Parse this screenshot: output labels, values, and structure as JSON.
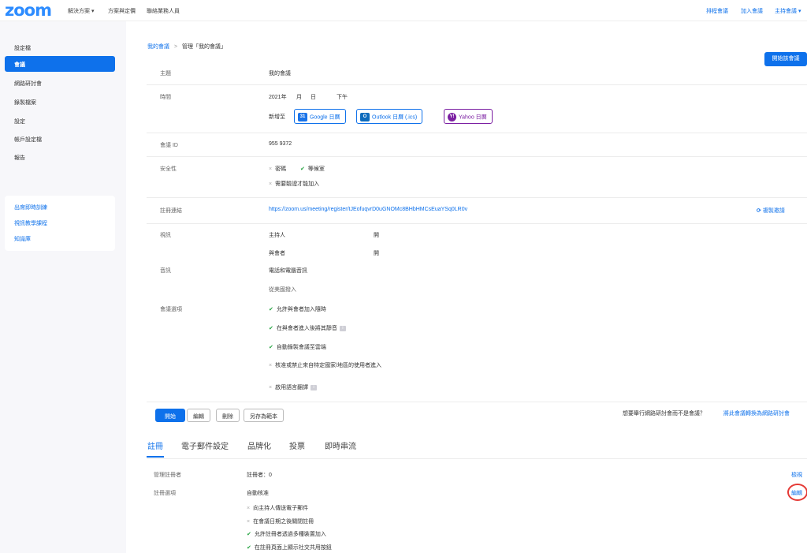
{
  "topbar": {
    "logo": "zoom",
    "nav": [
      "解決方案 ▾",
      "方案與定價",
      "聯絡業務人員"
    ],
    "right": [
      "排程會議",
      "加入會議",
      "主持會議 ▾"
    ]
  },
  "sidebar": {
    "items": [
      "設定檔",
      "會議",
      "網路研討會",
      "錄製檔案",
      "設定",
      "帳戶設定檔",
      "報告"
    ],
    "links": [
      "出席即時訓練",
      "視訊教學課程",
      "知識庫"
    ]
  },
  "breadcrumb": {
    "parent": "我的會議",
    "separator": ">",
    "current": "管理「我的會議」"
  },
  "start_meeting_button": "開始該會議",
  "meeting": {
    "topic_label": "主題",
    "topic": "我的會議",
    "time_label": "時間",
    "time_year": "2021年",
    "time_month": "月",
    "time_day": "日",
    "time_ampm": "下午",
    "add_to": "新增至",
    "google": "Google 日曆",
    "outlook": "Outlook 日曆 (.ics)",
    "yahoo": "Yahoo 日曆",
    "id_label": "會議 ID",
    "id": "955 9372",
    "security_label": "安全性",
    "security_passcode": "密碼",
    "security_waiting": "等候室",
    "security_auth": "需要驗證才能加入",
    "reg_link_label": "註冊連結",
    "reg_link": "https://zoom.us/meeting/register/tJEofuqvrD0uGNOMc8BHbHMCsEuaYSq0LR0v",
    "copy_invite": "複製邀請",
    "video_label": "視訊",
    "video_host": "主持人",
    "video_host_val": "開",
    "video_participant": "與會者",
    "video_participant_val": "開",
    "audio_label": "音訊",
    "audio_value": "電話和電腦音訊",
    "audio_dialin": "從美國撥入",
    "options_label": "會議選項",
    "opt1": "允許與會者加入隨時",
    "opt2": "在與會者進入後將其靜音",
    "opt3": "自動錄製會議至雲端",
    "opt4": "核准或禁止來自特定國家/地區的使用者進入",
    "opt5": "啟用語言翻譯"
  },
  "actions": {
    "start": "開始",
    "edit": "編輯",
    "delete": "刪除",
    "save_template": "另存為範本",
    "webinar_prompt": "想要舉行網路研討會而不是會議？",
    "webinar_link": "將此會議轉換為網路研討會"
  },
  "tabs": [
    "註冊",
    "電子郵件設定",
    "品牌化",
    "投票",
    "即時串流"
  ],
  "registration": {
    "manage_label": "管理註冊者",
    "count": "註冊者：0",
    "view": "檢視",
    "options_label": "註冊選項",
    "approval": "自動核准",
    "edit": "編輯",
    "r1": "向主持人傳送電子郵件",
    "r2": "在會議日期之後關閉註冊",
    "r3": "允許註冊者透過多種裝置加入",
    "r4": "在註冊頁面上顯示社交共用按鈕"
  },
  "colors": {
    "accent": "#0e71eb",
    "check": "#23a33f",
    "highlight_circle": "#e53935"
  }
}
